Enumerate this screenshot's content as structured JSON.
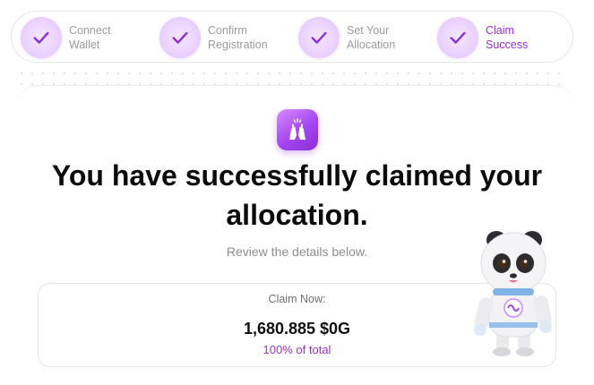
{
  "stepper": {
    "steps": [
      {
        "line1": "Connect",
        "line2": "Wallet"
      },
      {
        "line1": "Confirm",
        "line2": "Registration"
      },
      {
        "line1": "Set Your",
        "line2": "Allocation"
      },
      {
        "line1": "Claim",
        "line2": "Success"
      }
    ]
  },
  "main": {
    "headline_line1": "You have successfully claimed your",
    "headline_line2": "allocation.",
    "subtext": "Review the details below."
  },
  "claim": {
    "title": "Claim Now:",
    "amount": "1,680.885 $0G",
    "percent": "100% of total"
  },
  "colors": {
    "accent": "#9b2fd6",
    "step_circle": "#ead2ff",
    "check": "#8a2be2"
  },
  "icons": [
    "check-icon",
    "high-five-icon",
    "panda-astronaut-mascot"
  ]
}
